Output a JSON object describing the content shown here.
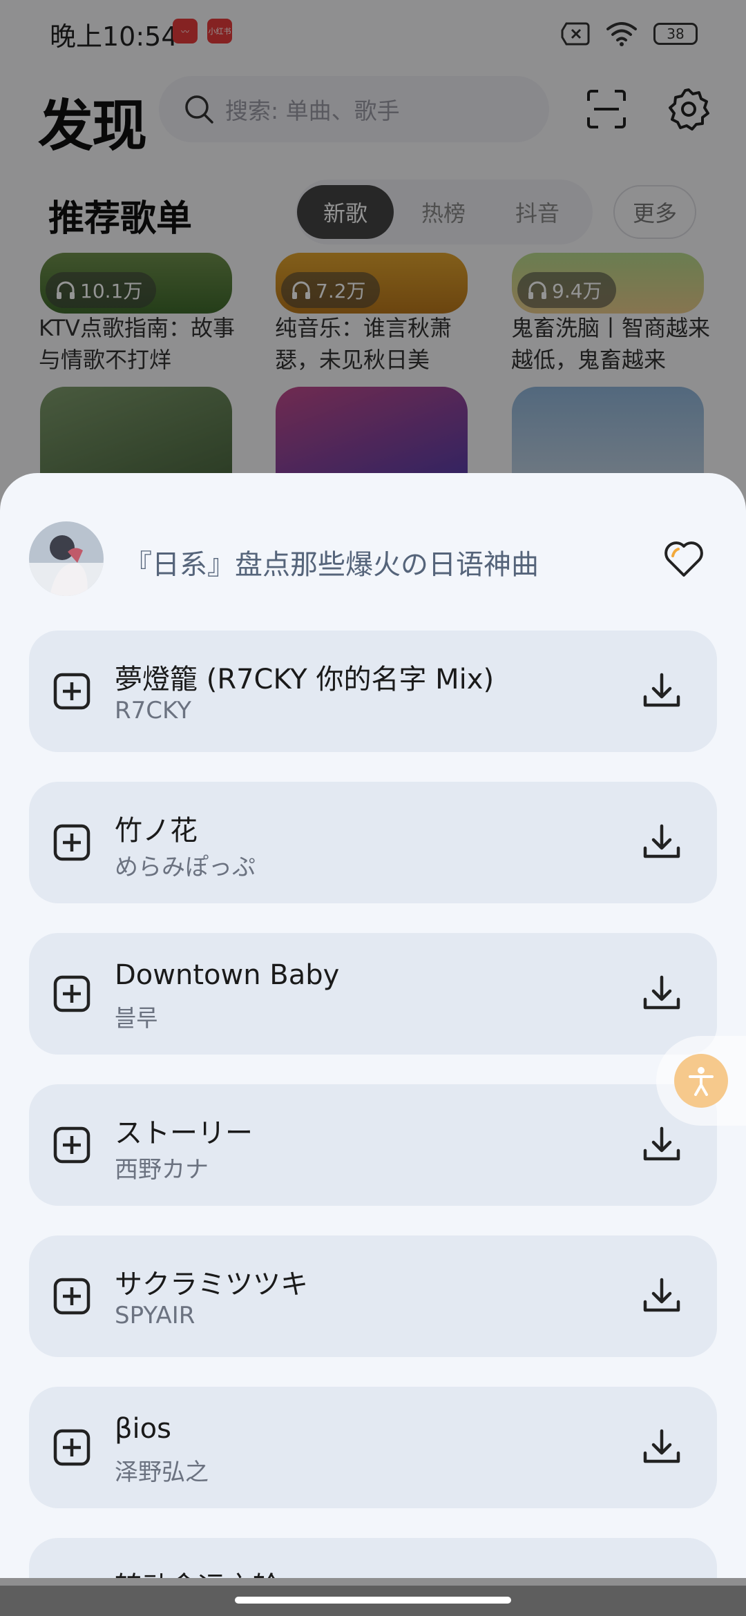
{
  "status_bar": {
    "time": "晚上10:54",
    "badge1": "〰",
    "badge2": "小红书",
    "battery": "38"
  },
  "header": {
    "title": "发现",
    "search_placeholder": "搜索: 单曲、歌手"
  },
  "section": {
    "title": "推荐歌单",
    "tabs": [
      "新歌",
      "热榜",
      "抖音"
    ],
    "active_tab": "新歌",
    "more": "更多"
  },
  "cards": [
    {
      "plays": "10.1万",
      "title": "KTV点歌指南：故事与情歌不打烊"
    },
    {
      "plays": "7.2万",
      "title": "纯音乐：谁言秋萧瑟，未见秋日美"
    },
    {
      "plays": "9.4万",
      "title": "鬼畜洗脑丨智商越来越低，鬼畜越来"
    }
  ],
  "sheet": {
    "playlist_title": "『日系』盘点那些爆火の日语神曲",
    "songs": [
      {
        "title": "夢燈籠 (R7CKY 你的名字 Mix)",
        "artist": "R7CKY"
      },
      {
        "title": "竹ノ花",
        "artist": "めらみぽっぷ"
      },
      {
        "title": "Downtown Baby",
        "artist": "블루"
      },
      {
        "title": "ストーリー",
        "artist": "西野カナ"
      },
      {
        "title": "サクラミツツキ",
        "artist": "SPYAIR"
      },
      {
        "title": "βios",
        "artist": "泽野弘之"
      },
      {
        "title": "转动命运之轮",
        "artist": ""
      }
    ]
  },
  "colors": {
    "accent": "#f6c98c",
    "sheet_bg": "#f3f6fb",
    "row_bg": "#e3e9f2"
  }
}
